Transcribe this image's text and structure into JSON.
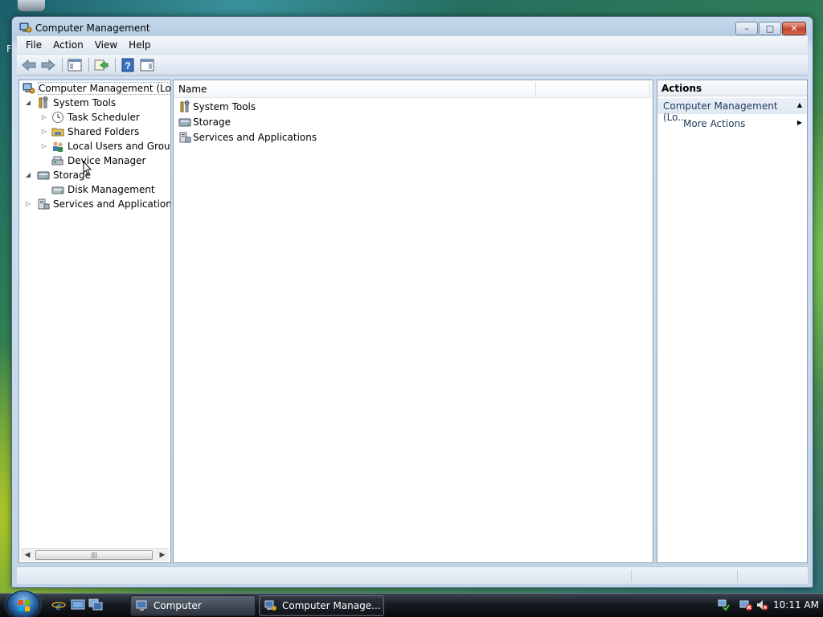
{
  "window": {
    "title": "Computer Management",
    "caption_buttons": [
      "minimize-icon",
      "maximize-icon",
      "close-icon"
    ]
  },
  "menubar": {
    "items": [
      "File",
      "Action",
      "View",
      "Help"
    ]
  },
  "toolbar": {
    "buttons": [
      "back-arrow-icon",
      "forward-arrow-icon",
      "show-hide-console-tree-icon",
      "export-list-icon",
      "help-icon",
      "show-hide-action-pane-icon"
    ]
  },
  "tree": {
    "root": "Computer Management (Local",
    "items": [
      {
        "label": "System Tools",
        "icon": "tools-icon",
        "expanded": true
      },
      {
        "label": "Task Scheduler",
        "icon": "clock-icon",
        "expanded": false
      },
      {
        "label": "Shared Folders",
        "icon": "shared-folder-icon",
        "expanded": false
      },
      {
        "label": "Local Users and Groups",
        "icon": "users-icon",
        "expanded": false
      },
      {
        "label": "Device Manager",
        "icon": "device-manager-icon"
      },
      {
        "label": "Storage",
        "icon": "storage-icon",
        "expanded": true
      },
      {
        "label": "Disk Management",
        "icon": "disk-icon"
      },
      {
        "label": "Services and Applications",
        "icon": "services-icon",
        "expanded": false
      }
    ]
  },
  "list": {
    "column_header": "Name",
    "rows": [
      {
        "label": "System Tools",
        "icon": "tools-icon"
      },
      {
        "label": "Storage",
        "icon": "storage-icon"
      },
      {
        "label": "Services and Applications",
        "icon": "services-icon"
      }
    ]
  },
  "actions": {
    "header": "Actions",
    "section": "Computer Management (Lo...",
    "items": [
      "More Actions"
    ]
  },
  "desktop": {
    "fragment": "F"
  },
  "taskbar": {
    "buttons": [
      {
        "label": "Computer",
        "icon": "computer-icon"
      },
      {
        "label": "Computer Manage...",
        "icon": "computer-management-icon"
      }
    ],
    "quick_launch": [
      "internet-explorer-icon",
      "show-desktop-icon",
      "switch-windows-icon"
    ],
    "tray_icons": [
      "network-icon",
      "security-alert-icon",
      "volume-muted-icon"
    ],
    "clock": "10:11 AM"
  },
  "colors": {
    "window_frame": "#c5d8ea",
    "taskbar": "#161b22",
    "close_button": "#c3412b",
    "action_link": "#1e395b"
  }
}
